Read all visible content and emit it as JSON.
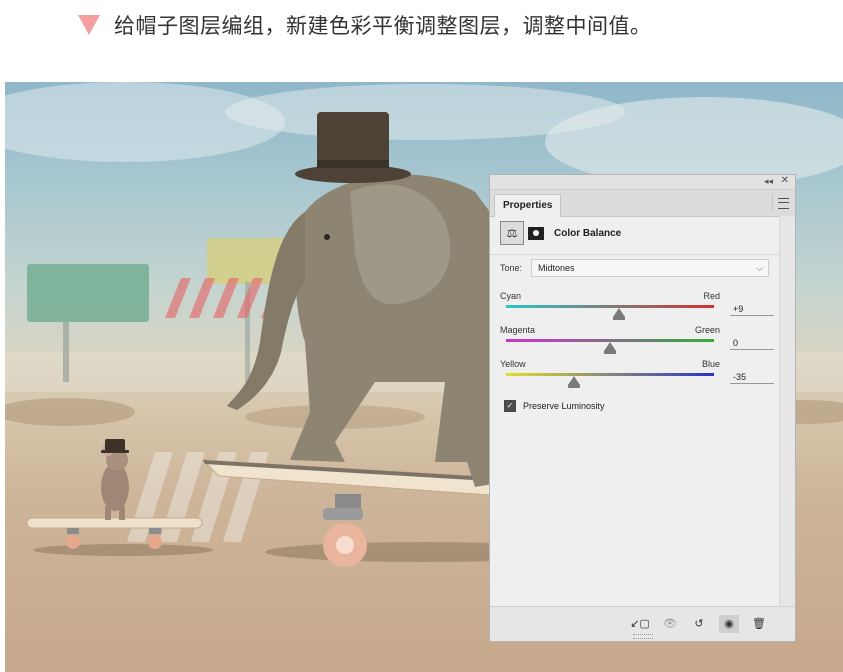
{
  "caption": {
    "text": "给帽子图层编组，新建色彩平衡调整图层，调整中间值。",
    "marker_color": "#f4a0a0"
  },
  "panel": {
    "collapse_glyph": "◂◂",
    "close_glyph": "✕",
    "tab_label": "Properties",
    "menu_icon": "panel-menu-icon",
    "header": {
      "adjustment_icon": "balance-scale-icon",
      "mask_icon": "layer-mask-icon",
      "title": "Color Balance"
    },
    "tone": {
      "label": "Tone:",
      "value": "Midtones"
    },
    "sliders": [
      {
        "left": "Cyan",
        "right": "Red",
        "value": "+9",
        "level": 9,
        "from": "#2bc6c8",
        "to": "#d2322f"
      },
      {
        "left": "Magenta",
        "right": "Green",
        "value": "0",
        "level": 0,
        "from": "#d32fcf",
        "to": "#2fae3c"
      },
      {
        "left": "Yellow",
        "right": "Blue",
        "value": "-35",
        "level": -35,
        "from": "#e1de2c",
        "to": "#2a32c6"
      }
    ],
    "preserve": {
      "label": "Preserve Luminosity",
      "checked": true
    },
    "footer": {
      "clip_icon": "clip-to-layer-icon",
      "view_previous_icon": "view-previous-state-icon",
      "reset_icon": "reset-icon",
      "visibility_icon": "visibility-eye-icon",
      "delete_icon": "trash-icon"
    }
  }
}
